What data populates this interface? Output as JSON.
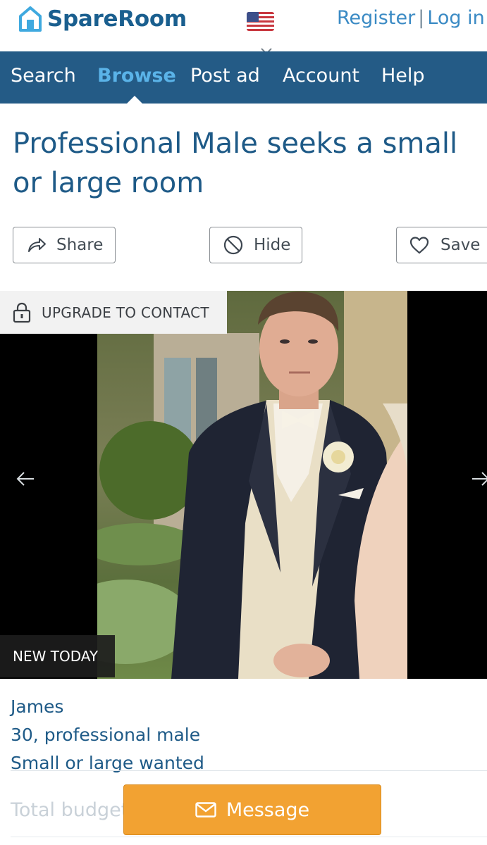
{
  "header": {
    "brand": "SpareRoom",
    "register_label": "Register",
    "separator": "|",
    "login_label": "Log in",
    "country_flag": "us-flag-icon"
  },
  "nav": {
    "items": [
      {
        "label": "Search",
        "active": false
      },
      {
        "label": "Browse",
        "active": true
      },
      {
        "label": "Post ad",
        "active": false
      },
      {
        "label": "Account",
        "active": false
      },
      {
        "label": "Help",
        "active": false
      }
    ]
  },
  "listing": {
    "title": "Professional Male seeks a small or large room",
    "actions": {
      "share_label": "Share",
      "hide_label": "Hide",
      "save_label": "Save"
    },
    "gallery": {
      "upgrade_label": "UPGRADE TO CONTACT",
      "badge": "NEW TODAY",
      "photo_description_icon": "profile-photo"
    },
    "name": "James",
    "age_line": "30, professional male",
    "wanted_line": "Small or large wanted",
    "budget_label": "Total budget"
  },
  "cta": {
    "message_label": "Message"
  },
  "colors": {
    "nav_bg": "#245b86",
    "brand": "#1a5f8f",
    "active_nav": "#5ab3e8",
    "message_button": "#f2a232"
  }
}
